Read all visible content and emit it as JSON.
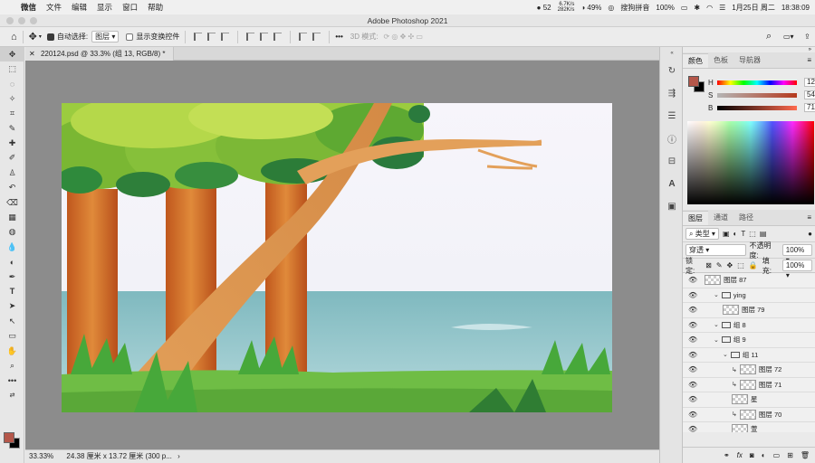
{
  "macbar": {
    "app": "微信",
    "menus": [
      "文件",
      "编辑",
      "显示",
      "窗口",
      "帮助"
    ],
    "badge": "52",
    "net_up": "6.7K/s",
    "net_down": "282K/s",
    "battery_pct": "49%",
    "ime": "搜狗拼音",
    "battery2": "100%",
    "date": "1月25日 周二",
    "time": "18:38:09"
  },
  "window_title": "Adobe Photoshop 2021",
  "options": {
    "auto_select_label": "自动选择:",
    "auto_select_value": "图层",
    "show_transform": "显示变换控件",
    "mode3d": "3D 模式:"
  },
  "document": {
    "tab": "220124.psd @ 33.3% (组 13, RGB/8) *",
    "zoom": "33.33%",
    "size": "24.38 厘米 x 13.72 厘米 (300 p..."
  },
  "colors": {
    "foreground": "#b5574a",
    "background": "#000000"
  },
  "color_panel": {
    "tabs": [
      "颜色",
      "色板",
      "导航器"
    ],
    "h_label": "H",
    "h_value": "12",
    "h_unit": "°",
    "s_label": "S",
    "s_value": "54",
    "s_unit": "%",
    "b_label": "B",
    "b_value": "71",
    "b_unit": "%"
  },
  "layers_panel": {
    "tabs": [
      "图层",
      "通道",
      "路径"
    ],
    "filter_label": "类型",
    "blend_mode": "穿透",
    "opacity_label": "不透明度:",
    "opacity_value": "100%",
    "lock_label": "锁定:",
    "fill_label": "填充:",
    "fill_value": "100%",
    "rows": [
      {
        "name": "图层 87",
        "kind": "layer",
        "indent": 0
      },
      {
        "name": "ying",
        "kind": "group-open",
        "indent": 1
      },
      {
        "name": "图层 79",
        "kind": "layer",
        "indent": 2
      },
      {
        "name": "组 8",
        "kind": "group-open",
        "indent": 1
      },
      {
        "name": "组 9",
        "kind": "group-open",
        "indent": 1
      },
      {
        "name": "组 11",
        "kind": "group-open",
        "indent": 2
      },
      {
        "name": "图层 72",
        "kind": "clip",
        "indent": 3
      },
      {
        "name": "图层 71",
        "kind": "clip",
        "indent": 3
      },
      {
        "name": "星",
        "kind": "layer",
        "indent": 3
      },
      {
        "name": "图层 70",
        "kind": "clip",
        "indent": 3
      },
      {
        "name": "萱",
        "kind": "layer",
        "indent": 3
      },
      {
        "name": "组 ...",
        "kind": "group-open",
        "indent": 2
      }
    ],
    "footer_fx": "fx"
  }
}
